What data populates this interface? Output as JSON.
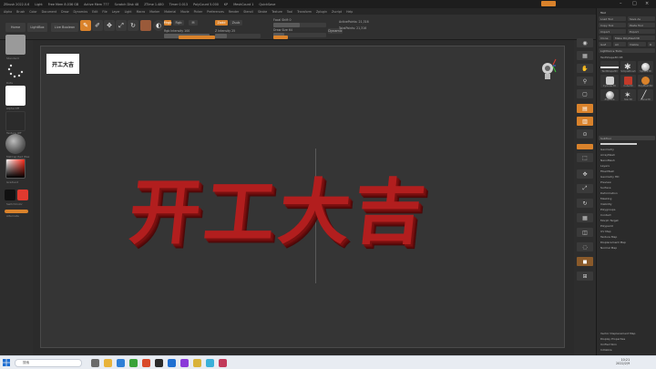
{
  "titlebar": {
    "app_title": "ZBrush 2022.0.6",
    "items": [
      "Light",
      "Free Mem 8.036 GB",
      "Active Mem 777",
      "Scratch Disk 48",
      "ZTime 1.480",
      "Timer 0.013",
      "PolyCount 5.000",
      "KP",
      "MeshCount 1",
      "QuickSave"
    ],
    "accent": "#d9822b"
  },
  "menubar": {
    "items": [
      "Alpha",
      "Brush",
      "Color",
      "Document",
      "Draw",
      "Dynamics",
      "Edit",
      "File",
      "Layer",
      "Light",
      "Macro",
      "Marker",
      "Material",
      "Movie",
      "Picker",
      "Preferences",
      "Render",
      "Stencil",
      "Stroke",
      "Texture",
      "Tool",
      "Transform",
      "Zplugin",
      "Zscript",
      "Help"
    ]
  },
  "topshelf": {
    "home": "Home",
    "lightbox": "LightBox",
    "live_boolean": "Live Boolean",
    "mrgb": "Mrgb",
    "rgb": "Rgb",
    "m": "M",
    "zadd": "Zadd",
    "zsub": "Zsub",
    "focal_shift": "Focal Shift 0",
    "draw_size": "Draw Size 64",
    "dynamic": "Dynamic",
    "rgb_intensity": "Rgb Intensity 100",
    "z_intensity": "Z Intensity 25",
    "active_points": "ActivePoints: 21,316",
    "total_points": "TotalPoints: 21,316"
  },
  "leftshelf": {
    "labels": [
      "Standard",
      "Dots",
      "Alpha Off",
      "Texture Off",
      "MatCap Red Wax",
      "Gradient",
      "SwitchColor",
      "Alternate"
    ],
    "main_color": "#e03a2f",
    "secondary_color": "#111111"
  },
  "viewport": {
    "thumbnail_text": "开工大吉",
    "main_text": "开工大吉",
    "text_color": "#b21e1e"
  },
  "rightstrip": {
    "icons": [
      "BPR",
      "SPix",
      "Scroll",
      "Zoom",
      "Actual",
      "AAHalf",
      "Persp",
      "Floor",
      "Local",
      "L.Sym",
      "Frame",
      "Move",
      "Scale",
      "Rotate",
      "PolyF",
      "Transp",
      "Ghost",
      "Solo",
      "Xpose"
    ]
  },
  "rpanel": {
    "title": "Tool",
    "rows": [
      "Load Tool",
      "Save As",
      "Copy Tool",
      "Paste Tool",
      "Import",
      "Export",
      "Clone",
      "Make PolyMesh3D",
      "GoZ",
      "All",
      "Visible",
      "R",
      "Lightbox ▸ Tools",
      "TextShape3D 48"
    ],
    "brushes": [
      "TextShape3D",
      "SimpleBrush",
      "Sphere3D",
      "Cylinder3D",
      "Cube3D",
      "PolyMesh3D",
      "ZSphere",
      "Star3D",
      "Plane3D"
    ],
    "subtool_rows": [
      "SubTool",
      "Geometry",
      "ArrayMesh",
      "NanoMesh",
      "Layers",
      "FiberMesh",
      "Geometry HD",
      "Preview",
      "Surface",
      "Deformation",
      "Masking",
      "Visibility",
      "Polygroups",
      "Contact",
      "Morph Target",
      "Polypaint",
      "UV Map",
      "Texture Map",
      "Displacement Map",
      "Normal Map"
    ],
    "footer": [
      "Vector Displacement Map",
      "Display Properties",
      "Unified Skin",
      "Initialize",
      "Import",
      "Export"
    ]
  },
  "taskbar": {
    "search_placeholder": "搜索",
    "time": "10:21",
    "date": "2022/2/9"
  }
}
